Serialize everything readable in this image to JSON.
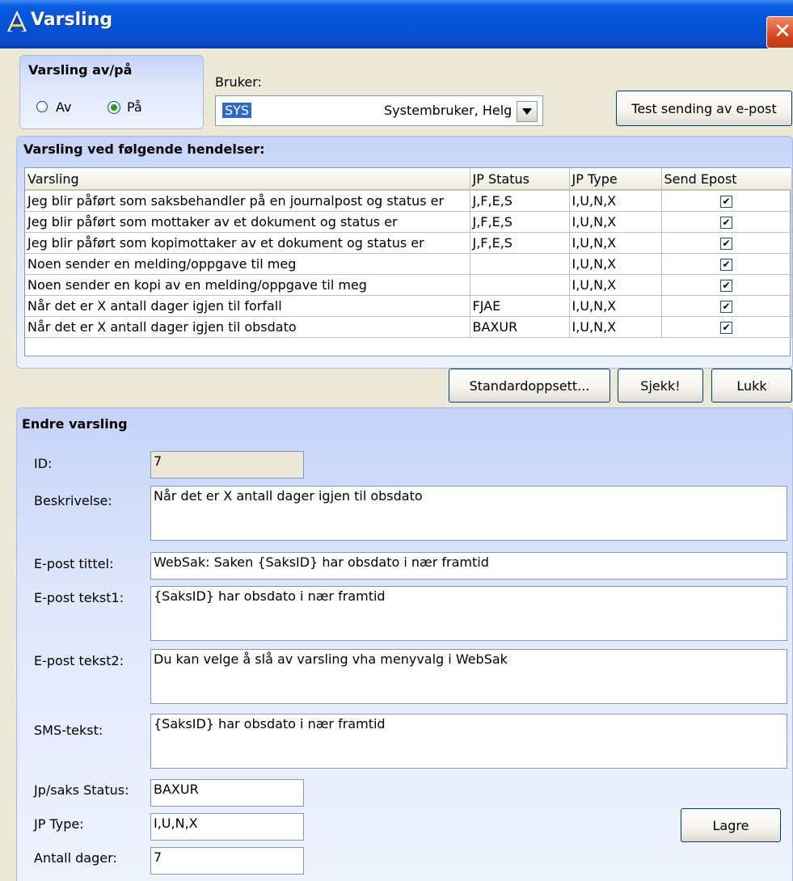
{
  "window": {
    "title": "Varsling",
    "close_glyph": "✕"
  },
  "varsling_toggle": {
    "title": "Varsling av/på",
    "option_off": "Av",
    "option_on": "På",
    "selected": "På"
  },
  "user": {
    "label": "Bruker:",
    "code": "SYS",
    "name": "Systembruker, Helg"
  },
  "test_button": "Test sending av e-post",
  "events": {
    "title": "Varsling ved følgende hendelser:",
    "columns": [
      "Varsling",
      "JP Status",
      "JP Type",
      "Send Epost"
    ],
    "rows": [
      {
        "varsling": "Jeg blir påført som saksbehandler på en journalpost og status er",
        "jp_status": "J,F,E,S",
        "jp_type": "I,U,N,X",
        "send": "✔"
      },
      {
        "varsling": "Jeg blir påført som mottaker av et dokument og status er",
        "jp_status": "J,F,E,S",
        "jp_type": "I,U,N,X",
        "send": "✔"
      },
      {
        "varsling": "Jeg blir påført som kopimottaker av et dokument og status er",
        "jp_status": "J,F,E,S",
        "jp_type": "I,U,N,X",
        "send": "✔"
      },
      {
        "varsling": "Noen sender en melding/oppgave til meg",
        "jp_status": "",
        "jp_type": "I,U,N,X",
        "send": "✔"
      },
      {
        "varsling": "Noen sender en kopi av en melding/oppgave til meg",
        "jp_status": "",
        "jp_type": "I,U,N,X",
        "send": "✔"
      },
      {
        "varsling": "Når det er X antall dager igjen til forfall",
        "jp_status": "FJAE",
        "jp_type": "I,U,N,X",
        "send": "✔"
      },
      {
        "varsling": "Når det er X antall dager igjen til obsdato",
        "jp_status": "BAXUR",
        "jp_type": "I,U,N,X",
        "send": "✔"
      }
    ]
  },
  "actions": {
    "standard": "Standardoppsett...",
    "check": "Sjekk!",
    "close": "Lukk"
  },
  "edit": {
    "title": "Endre varsling",
    "id_label": "ID:",
    "id_value": "7",
    "desc_label": "Beskrivelse:",
    "desc_value": "Når det er X antall dager igjen til obsdato",
    "subject_label": "E-post tittel:",
    "subject_value": "WebSak: Saken {SaksID} har obsdato i nær framtid",
    "text1_label": "E-post tekst1:",
    "text1_value": "{SaksID} har obsdato i nær framtid",
    "text2_label": "E-post tekst2:",
    "text2_value": "Du kan velge å slå av varsling vha menyvalg i WebSak",
    "sms_label": "SMS-tekst:",
    "sms_value": "{SaksID} har obsdato i nær framtid",
    "status_label": "Jp/saks Status:",
    "status_value": "BAXUR",
    "type_label": "JP Type:",
    "type_value": "I,U,N,X",
    "days_label": "Antall dager:",
    "days_value": "7",
    "save_button": "Lagre"
  }
}
